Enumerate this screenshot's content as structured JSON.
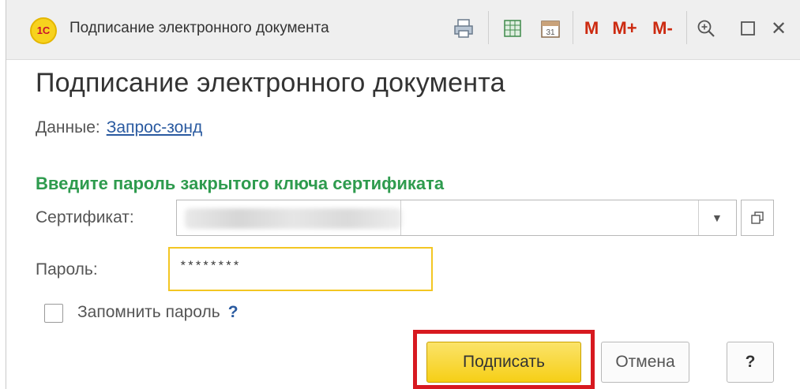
{
  "window": {
    "app_logo_text": "1С",
    "title": "Подписание электронного документа",
    "toolbar": {
      "m_label": "M",
      "m_plus_label": "M+",
      "m_minus_label": "M-",
      "calendar_day": "31",
      "close_symbol": "✕"
    }
  },
  "form": {
    "heading": "Подписание электронного документа",
    "data_label": "Данные:",
    "data_link": "Запрос-зонд",
    "section_title": "Введите пароль закрытого ключа сертификата",
    "certificate_label": "Сертификат:",
    "password_label": "Пароль:",
    "password_value": "********",
    "remember_label": "Запомнить пароль",
    "remember_help": "?",
    "remember_checked": false
  },
  "buttons": {
    "sign": "Подписать",
    "cancel": "Отмена",
    "help": "?"
  },
  "colors": {
    "accent_yellow": "#f6cf16",
    "section_green": "#2e9b4e",
    "link_blue": "#2a5aa0",
    "highlight_red": "#d71920",
    "toolbar_m_red": "#cc2a10"
  }
}
